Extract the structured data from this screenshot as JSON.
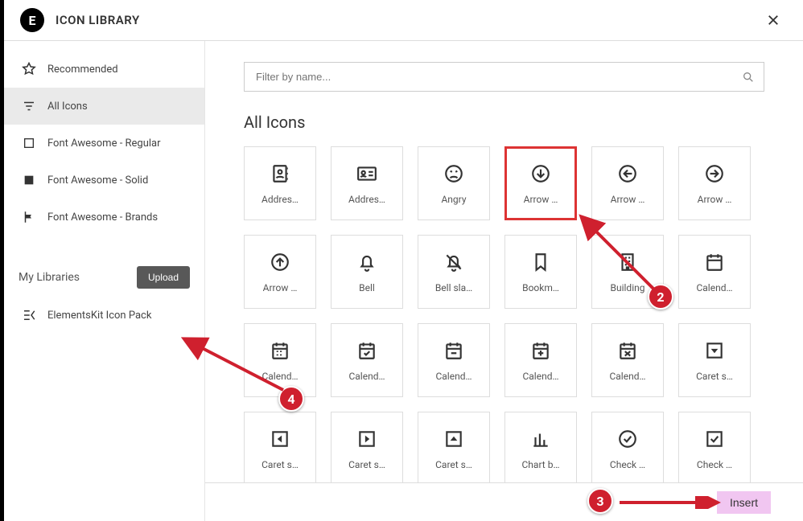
{
  "header": {
    "title": "ICON LIBRARY",
    "logo_text": "E"
  },
  "sidebar": {
    "items": [
      {
        "label": "Recommended",
        "icon": "star-icon",
        "active": false
      },
      {
        "label": "All Icons",
        "icon": "filter-lines-icon",
        "active": true
      },
      {
        "label": "Font Awesome - Regular",
        "icon": "square-outline-icon",
        "active": false
      },
      {
        "label": "Font Awesome - Solid",
        "icon": "square-solid-icon",
        "active": false
      },
      {
        "label": "Font Awesome - Brands",
        "icon": "flag-icon",
        "active": false
      }
    ],
    "my_libs_label": "My Libraries",
    "upload_label": "Upload",
    "libs": [
      {
        "label": "ElementsKit Icon Pack",
        "icon": "ek-icon"
      }
    ]
  },
  "search": {
    "placeholder": "Filter by name..."
  },
  "grid": {
    "title": "All Icons",
    "items": [
      {
        "label": "Addres…",
        "icon": "address-book-icon"
      },
      {
        "label": "Addres…",
        "icon": "address-card-icon"
      },
      {
        "label": "Angry",
        "icon": "angry-face-icon"
      },
      {
        "label": "Arrow …",
        "icon": "circle-arrow-down-icon",
        "selected": true
      },
      {
        "label": "Arrow …",
        "icon": "circle-arrow-left-icon"
      },
      {
        "label": "Arrow …",
        "icon": "circle-arrow-right-icon"
      },
      {
        "label": "Arrow …",
        "icon": "circle-arrow-up-icon"
      },
      {
        "label": "Bell",
        "icon": "bell-icon"
      },
      {
        "label": "Bell sla…",
        "icon": "bell-slash-icon"
      },
      {
        "label": "Bookm…",
        "icon": "bookmark-icon"
      },
      {
        "label": "Building",
        "icon": "building-icon"
      },
      {
        "label": "Calend…",
        "icon": "calendar-icon"
      },
      {
        "label": "Calend…",
        "icon": "calendar-alt-icon"
      },
      {
        "label": "Calend…",
        "icon": "calendar-check-icon"
      },
      {
        "label": "Calend…",
        "icon": "calendar-minus-icon"
      },
      {
        "label": "Calend…",
        "icon": "calendar-plus-icon"
      },
      {
        "label": "Calend…",
        "icon": "calendar-times-icon"
      },
      {
        "label": "Caret s…",
        "icon": "caret-square-down-icon"
      },
      {
        "label": "Caret s…",
        "icon": "caret-square-left-icon"
      },
      {
        "label": "Caret s…",
        "icon": "caret-square-right-icon"
      },
      {
        "label": "Caret s…",
        "icon": "caret-square-up-icon"
      },
      {
        "label": "Chart b…",
        "icon": "chart-bar-icon"
      },
      {
        "label": "Check …",
        "icon": "check-circle-icon"
      },
      {
        "label": "Check …",
        "icon": "check-square-icon"
      }
    ]
  },
  "footer": {
    "insert_label": "Insert"
  },
  "annotations": {
    "two": "2",
    "three": "3",
    "four": "4"
  }
}
